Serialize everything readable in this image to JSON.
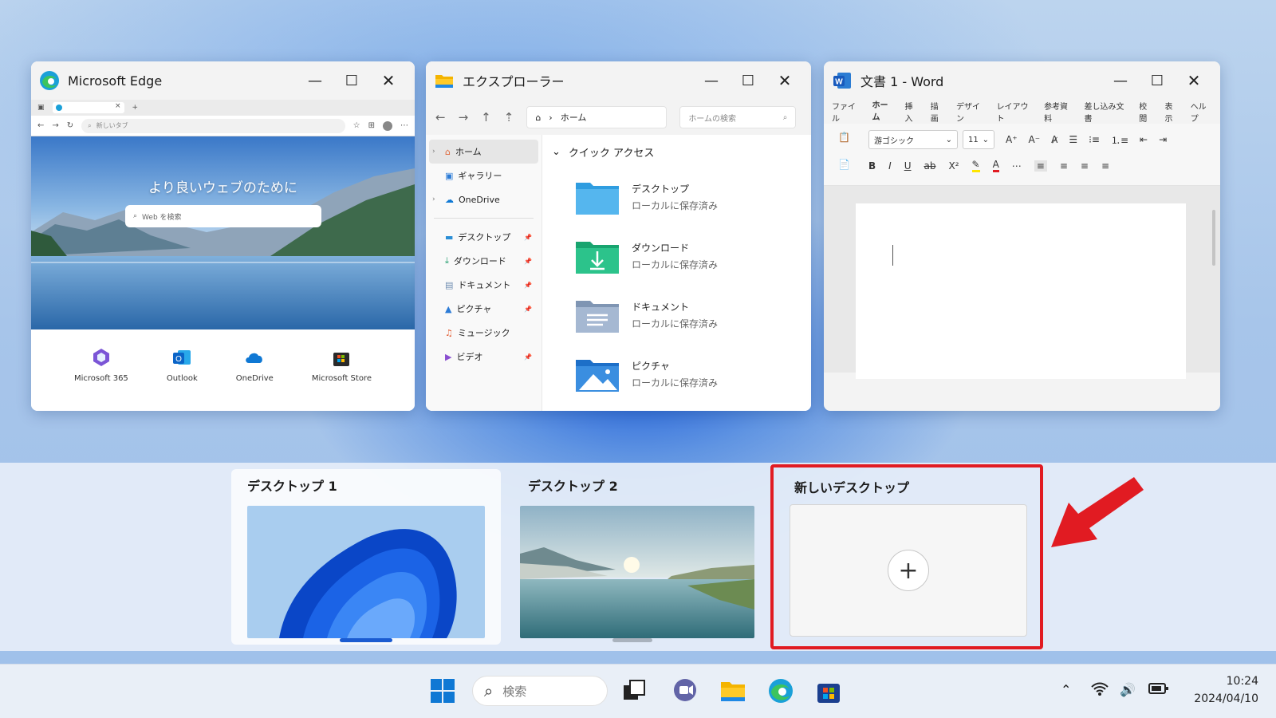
{
  "windows": {
    "edge": {
      "title": "Microsoft Edge",
      "tab_close": "×",
      "tab_add": "+",
      "address_placeholder": "新しいタブ",
      "headline": "より良いウェブのために",
      "search_placeholder": "Web を検索",
      "apps": [
        {
          "label": "Microsoft 365"
        },
        {
          "label": "Outlook"
        },
        {
          "label": "OneDrive"
        },
        {
          "label": "Microsoft Store"
        }
      ]
    },
    "explorer": {
      "title": "エクスプローラー",
      "path": "ホーム",
      "search_placeholder": "ホームの検索",
      "sidebar_top": [
        {
          "label": "ホーム"
        },
        {
          "label": "ギャラリー"
        },
        {
          "label": "OneDrive"
        }
      ],
      "sidebar_pinned": [
        {
          "label": "デスクトップ"
        },
        {
          "label": "ダウンロード"
        },
        {
          "label": "ドキュメント"
        },
        {
          "label": "ピクチャ"
        },
        {
          "label": "ミュージック"
        },
        {
          "label": "ビデオ"
        }
      ],
      "quick_access_title": "クイック アクセス",
      "quick_access": [
        {
          "name": "デスクトップ",
          "sub": "ローカルに保存済み"
        },
        {
          "name": "ダウンロード",
          "sub": "ローカルに保存済み"
        },
        {
          "name": "ドキュメント",
          "sub": "ローカルに保存済み"
        },
        {
          "name": "ピクチャ",
          "sub": "ローカルに保存済み"
        }
      ]
    },
    "word": {
      "title": "文書 1 - Word",
      "menu": [
        "ファイル",
        "ホーム",
        "挿入",
        "描画",
        "デザイン",
        "レイアウト",
        "参考資料",
        "差し込み文書",
        "校閲",
        "表示",
        "ヘルプ"
      ],
      "active_menu": "ホーム",
      "font_name": "游ゴシック",
      "font_size": "11"
    }
  },
  "controls": {
    "minimize": "—",
    "maximize": "☐",
    "close": "✕"
  },
  "taskview": {
    "desktops": [
      {
        "label": "デスクトップ 1",
        "active": true
      },
      {
        "label": "デスクトップ 2",
        "active": false
      }
    ],
    "new_desktop_label": "新しいデスクトップ",
    "new_desktop_button": "+",
    "highlight_color": "#e11b22"
  },
  "taskbar": {
    "search_placeholder": "検索",
    "time": "10:24",
    "date": "2024/04/10"
  },
  "colors": {
    "accent": "#185abd",
    "active_indicator": "#1a5bd1"
  }
}
